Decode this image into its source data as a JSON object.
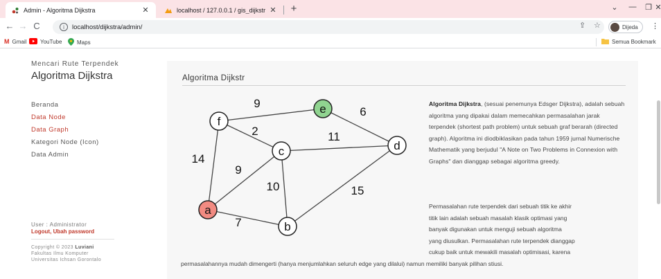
{
  "browser": {
    "tabs": [
      {
        "title": "Admin - Algoritma Dijkstra",
        "active": true
      },
      {
        "title": "localhost / 127.0.0.1 / gis_dijkstr",
        "active": false
      }
    ],
    "url": "localhost/dijkstra/admin/",
    "profile_name": "Dijeda",
    "bookmarks": [
      "Gmail",
      "YouTube",
      "Maps"
    ],
    "all_bookmarks": "Semua Bookmark"
  },
  "sidebar": {
    "subtitle": "Mencari Rute Terpendek",
    "title": "Algoritma Dijkstra",
    "nav": [
      {
        "label": "Beranda"
      },
      {
        "label": "Data Node"
      },
      {
        "label": "Data Graph"
      },
      {
        "label": "Kategori Node (Icon)"
      },
      {
        "label": "Data Admin"
      }
    ],
    "user_line": "User : Administrator",
    "logout": "Logout",
    "change_password": "Ubah password",
    "copyright": {
      "line1_prefix": "Copyright © 2023",
      "line1_name": "Luviani",
      "line2": "Fakultas Ilmu Komputer",
      "line3": "Universitas Ichsan Gorontalo"
    }
  },
  "main": {
    "heading": "Algoritma Dijkstr",
    "paragraph1_bold": "Algoritma Dijkstra",
    "paragraph1_rest": ", (sesuai penemunya Edsger Dijkstra), adalah sebuah algoritma yang dipakai dalam memecahkan permasalahan jarak terpendek (shortest path problem) untuk sebuah graf berarah (directed graph). Algoritma ini diodbiklasikan pada tahun 1959 jurnal Numerische Mathematik yang berjudul \"A Note on Two Problems in Connexion with Graphs\" dan dianggap sebagai algoritma greedy.",
    "paragraph2_lines": [
      "Permasalahan rute terpendek dari sebuah titik ke akhir",
      "titik lain adalah sebuah masalah klasik optimasi yang",
      "banyak digunakan untuk menguji sebuah algoritma",
      "yang diusulkan. Permasalahan rute terpendek dianggap",
      "cukup baik untuk mewakili masalah optimisasi, karena"
    ],
    "paragraph2_last": "permasalahannya mudah dimengerti (hanya menjumlahkan seluruh edge yang dilalui) namun memiliki banyak pilihan stiusi."
  },
  "graph": {
    "nodes": [
      {
        "id": "a",
        "fill": "#f28b82"
      },
      {
        "id": "b",
        "fill": "#ffffff"
      },
      {
        "id": "c",
        "fill": "#ffffff"
      },
      {
        "id": "d",
        "fill": "#ffffff"
      },
      {
        "id": "e",
        "fill": "#90d490"
      },
      {
        "id": "f",
        "fill": "#ffffff"
      }
    ],
    "edges": [
      {
        "from": "f",
        "to": "e",
        "weight": "9"
      },
      {
        "from": "e",
        "to": "d",
        "weight": "6"
      },
      {
        "from": "f",
        "to": "c",
        "weight": "2"
      },
      {
        "from": "c",
        "to": "d",
        "weight": "11"
      },
      {
        "from": "f",
        "to": "a",
        "weight": "14"
      },
      {
        "from": "a",
        "to": "c",
        "weight": "9"
      },
      {
        "from": "c",
        "to": "b",
        "weight": "10"
      },
      {
        "from": "b",
        "to": "d",
        "weight": "15"
      },
      {
        "from": "a",
        "to": "b",
        "weight": "7"
      }
    ]
  }
}
